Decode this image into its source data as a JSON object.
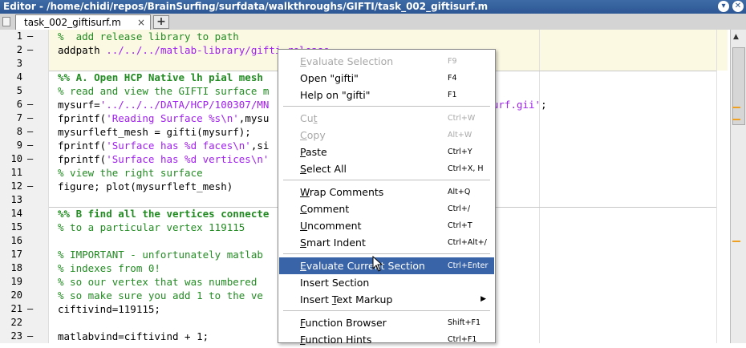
{
  "window": {
    "title": "Editor - /home/chidi/repos/BrainSurfing/surfdata/walkthroughs/GIFTI/task_002_giftisurf.m"
  },
  "tabs": [
    {
      "label": "task_002_giftisurf.m",
      "close": "×"
    }
  ],
  "add_tab": "+",
  "lines": [
    {
      "n": "1",
      "d": "–",
      "parts": [
        {
          "t": "%  add release library to path",
          "c": "cm"
        }
      ]
    },
    {
      "n": "2",
      "d": "–",
      "parts": [
        {
          "t": "addpath ",
          "c": ""
        },
        {
          "t": "../../../matlab-library/gifti-release",
          "c": "str"
        }
      ]
    },
    {
      "n": "3",
      "d": "",
      "parts": []
    },
    {
      "n": "4",
      "d": "",
      "parts": [
        {
          "t": "%% A. Open HCP Native lh pial mesh",
          "c": "cmb"
        }
      ]
    },
    {
      "n": "5",
      "d": "",
      "parts": [
        {
          "t": "% read and view the GIFTI surface m",
          "c": "cm"
        }
      ]
    },
    {
      "n": "6",
      "d": "–",
      "parts": [
        {
          "t": "mysurf=",
          "c": ""
        },
        {
          "t": "'../../../DATA/HCP/100307/MN",
          "c": "str"
        },
        {
          "t": "                              ",
          "c": ""
        },
        {
          "t": "ative.surf.gii'",
          "c": "str"
        },
        {
          "t": ";",
          "c": ""
        }
      ]
    },
    {
      "n": "7",
      "d": "–",
      "parts": [
        {
          "t": "fprintf(",
          "c": ""
        },
        {
          "t": "'Reading Surface %s\\n'",
          "c": "str"
        },
        {
          "t": ",mysu",
          "c": ""
        }
      ]
    },
    {
      "n": "8",
      "d": "–",
      "parts": [
        {
          "t": "mysurfleft_mesh = gifti(mysurf);",
          "c": ""
        }
      ]
    },
    {
      "n": "9",
      "d": "–",
      "parts": [
        {
          "t": "fprintf(",
          "c": ""
        },
        {
          "t": "'Surface has %d faces\\n'",
          "c": "str"
        },
        {
          "t": ",si",
          "c": ""
        }
      ]
    },
    {
      "n": "10",
      "d": "–",
      "parts": [
        {
          "t": "fprintf(",
          "c": ""
        },
        {
          "t": "'Surface has %d vertices\\n'",
          "c": "str"
        },
        {
          "t": "                                  ",
          "c": ""
        },
        {
          "t": ");",
          "c": ""
        }
      ]
    },
    {
      "n": "11",
      "d": "",
      "parts": [
        {
          "t": "% view the right surface",
          "c": "cm"
        }
      ]
    },
    {
      "n": "12",
      "d": "–",
      "parts": [
        {
          "t": "figure; plot(mysurfleft_mesh)",
          "c": ""
        }
      ]
    },
    {
      "n": "13",
      "d": "",
      "parts": []
    },
    {
      "n": "14",
      "d": "",
      "parts": [
        {
          "t": "%% B find all the vertices connecte",
          "c": "cmb"
        }
      ]
    },
    {
      "n": "15",
      "d": "",
      "parts": [
        {
          "t": "% to a particular vertex 119115",
          "c": "cm"
        }
      ]
    },
    {
      "n": "16",
      "d": "",
      "parts": []
    },
    {
      "n": "17",
      "d": "",
      "parts": [
        {
          "t": "% IMPORTANT - unfortunately matlab",
          "c": "cm"
        },
        {
          "t": "                                 ",
          "c": ""
        },
        {
          "t": "iew",
          "c": "cm"
        }
      ]
    },
    {
      "n": "18",
      "d": "",
      "parts": [
        {
          "t": "% indexes from 0!",
          "c": "cm"
        }
      ]
    },
    {
      "n": "19",
      "d": "",
      "parts": [
        {
          "t": "% so our vertex that was numbered",
          "c": "cm"
        },
        {
          "t": "                                  ",
          "c": ""
        },
        {
          "t": "o",
          "c": "cm"
        }
      ]
    },
    {
      "n": "20",
      "d": "",
      "parts": [
        {
          "t": "% so make sure you add 1 to the ve",
          "c": "cm"
        }
      ]
    },
    {
      "n": "21",
      "d": "–",
      "parts": [
        {
          "t": "ciftivind=119115;",
          "c": ""
        }
      ]
    },
    {
      "n": "22",
      "d": "",
      "parts": []
    },
    {
      "n": "23",
      "d": "–",
      "parts": [
        {
          "t": "matlabvind=ciftivind + 1;",
          "c": ""
        }
      ]
    }
  ],
  "context_menu": [
    {
      "label": "Evaluate Selection",
      "shortcut": "F9",
      "disabled": true,
      "u": "E"
    },
    {
      "label": "Open \"gifti\"",
      "shortcut": "F4",
      "disabled": false,
      "u": ""
    },
    {
      "label": "Help on \"gifti\"",
      "shortcut": "F1",
      "disabled": false,
      "u": ""
    },
    {
      "sep": true
    },
    {
      "label": "Cut",
      "shortcut": "Ctrl+W",
      "disabled": true,
      "u": "t"
    },
    {
      "label": "Copy",
      "shortcut": "Alt+W",
      "disabled": true,
      "u": "C"
    },
    {
      "label": "Paste",
      "shortcut": "Ctrl+Y",
      "disabled": false,
      "u": "P"
    },
    {
      "label": "Select All",
      "shortcut": "Ctrl+X, H",
      "disabled": false,
      "u": "S"
    },
    {
      "sep": true
    },
    {
      "label": "Wrap Comments",
      "shortcut": "Alt+Q",
      "disabled": false,
      "u": "W"
    },
    {
      "label": "Comment",
      "shortcut": "Ctrl+/",
      "disabled": false,
      "u": "C"
    },
    {
      "label": "Uncomment",
      "shortcut": "Ctrl+T",
      "disabled": false,
      "u": "U"
    },
    {
      "label": "Smart Indent",
      "shortcut": "Ctrl+Alt+/",
      "disabled": false,
      "u": "S"
    },
    {
      "sep": true
    },
    {
      "label": "Evaluate Current Section",
      "shortcut": "Ctrl+Enter",
      "disabled": false,
      "selected": true,
      "u": "E"
    },
    {
      "label": "Insert Section",
      "shortcut": "",
      "disabled": false,
      "u": ""
    },
    {
      "label": "Insert Text Markup",
      "shortcut": "",
      "disabled": false,
      "submenu": true,
      "u": "T"
    },
    {
      "sep": true
    },
    {
      "label": "Function Browser",
      "shortcut": "Shift+F1",
      "disabled": false,
      "u": "F"
    },
    {
      "label": "Function Hints",
      "shortcut": "Ctrl+F1",
      "disabled": false,
      "u": "F"
    }
  ],
  "colors": {
    "title_bg": "#2c5795",
    "menu_highlight": "#3a64a8",
    "comment": "#228b22",
    "string": "#a020f0",
    "cell_bg": "#fbf9e2"
  },
  "icons": {
    "close": "close-icon",
    "minimize": "chevron-down-icon",
    "submenu": "chevron-right-icon"
  }
}
